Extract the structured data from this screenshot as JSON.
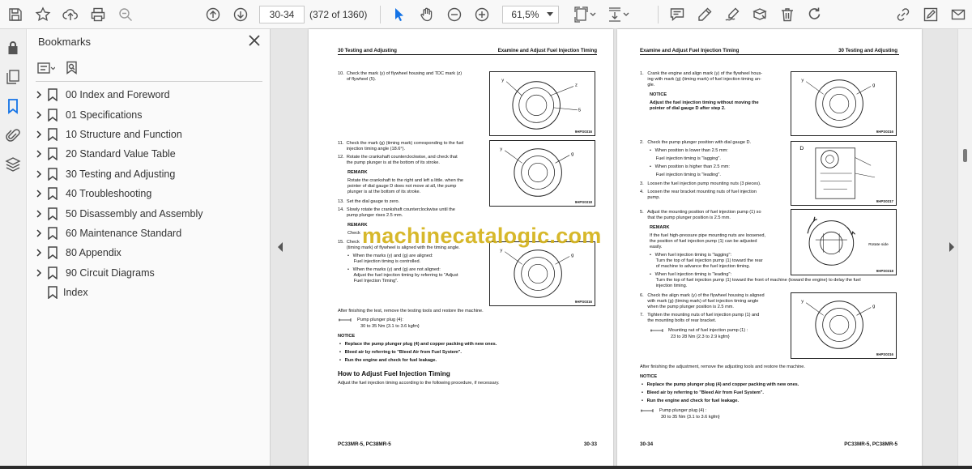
{
  "toolbar": {
    "page_current": "30-34",
    "page_of": "(372 of 1360)",
    "zoom": "61,5%"
  },
  "bookmarks": {
    "title": "Bookmarks",
    "items": [
      {
        "label": "00 Index and Foreword",
        "expandable": true
      },
      {
        "label": "01 Specifications",
        "expandable": true
      },
      {
        "label": "10 Structure and Function",
        "expandable": true
      },
      {
        "label": "20 Standard Value Table",
        "expandable": true
      },
      {
        "label": "30 Testing and Adjusting",
        "expandable": true
      },
      {
        "label": "40 Troubleshooting",
        "expandable": true
      },
      {
        "label": "50 Disassembly and Assembly",
        "expandable": true
      },
      {
        "label": "60 Maintenance Standard",
        "expandable": true
      },
      {
        "label": "80 Appendix",
        "expandable": true
      },
      {
        "label": "90 Circuit Diagrams",
        "expandable": true
      },
      {
        "label": "Index",
        "expandable": false
      }
    ]
  },
  "watermark": "machinecatalogic.com",
  "left_page": {
    "header_left": "30 Testing and Adjusting",
    "header_right": "Examine and Adjust Fuel Injection Timing",
    "footer_left": "PC33MR-5, PC38MR-5",
    "footer_right": "30-33",
    "lines": [
      "10.  Check the mark (y) of flywheel housing and TDC mark (z)",
      "       of flywheel (5).",
      "11.  Check the mark (g) (timing mark) corresponding to the fuel",
      "       injection timing angle (18.6°).",
      "12.  Rotate the crankshaft counterclockwise, and check that",
      "       the pump plunger is at the bottom of its stroke.",
      "REMARK",
      "Rotate the crankshaft to the right and left a little. when the",
      "pointer of dial gauge D does not move at all, the pump",
      "plunger is at the bottom of its stroke.",
      "13.  Set the dial gauge to zero.",
      "14.  Slowly rotate the crankshaft counterclockwise until the",
      "       pump plunger rises 2.5 mm.",
      "REMARK",
      "Check",
      "15.  Check",
      "       (timing mark) of flywheel is aligned with the timing angle.",
      "•   When the marks (y) and (g) are aligned:",
      "     Fuel injection timing is controlled.",
      "•   When the marks (y) and (g) are not aligned:",
      "     Adjust the fuel injection timing by referring to \"Adjust",
      "     Fuel Injection Timing\".",
      "After finishing the test, remove the testing tools and restore the machine.",
      "Pump plunger plug (4):",
      "30 to 35 Nm {3.1 to 3.6 kgfm}",
      "NOTICE",
      "•   Replace the pump plunger plug (4) and copper packing with new ones.",
      "•   Bleed air by referring to \"Bleed Air from Fuel System\".",
      "•   Run the engine and check for fuel leakage.",
      "How to Adjust Fuel Injection Timing",
      "Adjust the fuel injection timing according to the following procedure, if necessary."
    ],
    "fig_codes": [
      "9HPS0316",
      "9HPS0318",
      "9HPS0316"
    ]
  },
  "right_page": {
    "header_left": "Examine and Adjust Fuel Injection Timing",
    "header_right": "30 Testing and Adjusting",
    "footer_left": "30-34",
    "footer_right": "PC33MR-5, PC38MR-5",
    "lines": [
      "1.   Crank the engine and align mark (y) of the flywheel hous-",
      "      ing with mark (g) (timing mark) of fuel injection timing an-",
      "      gle.",
      "NOTICE",
      "Adjust the fuel injection timing without moving the",
      "pointer of dial gauge D after step 2.",
      "2.   Check the pump plunger position with dial gauge D.",
      "•   When position is lower than 2.5 mm:",
      "     Fuel injection timing is \"lagging\".",
      "•   When position is higher than 2.5 mm:",
      "     Fuel injection timing is \"leading\".",
      "3.   Loosen the fuel injection pump mounting nuts (3 pieces).",
      "4.   Loosen the rear bracket mounting nuts of fuel injection",
      "      pump.",
      "5.   Adjust the mounting position of fuel injection pump (1) so",
      "      that the pump plunger position is 2.5 mm.",
      "REMARK",
      "If the fuel high-pressure pipe mounting nuts are loosened,",
      "the position of fuel injection pump (1) can be adjusted",
      "easily.",
      "•   When fuel injection timing is \"lagging\":",
      "     Turn the top of fuel injection pump (1) toward the rear",
      "     of machine to advance the fuel injection timing.",
      "•   When fuel injection timing is \"leading\":",
      "     Turn the top of fuel injection pump (1) toward the front of machine (toward the engine) to delay the fuel",
      "     injection timing.",
      "6.   Check the align mark (y) of the flywheel housing is aligned",
      "      with mark (g) (timing mark) of fuel injection timing angle",
      "      when the pump plunger position is 2.5 mm.",
      "7.   Tighten the mounting nuts of fuel injection pump (1) and",
      "      the mounting bolts of rear bracket.",
      "Mounting nut of fuel injection pump (1) :",
      "23 to 28 Nm {2.3 to 2.9 kgfm}",
      "After finishing the adjustment, remove the adjusting tools and restore the machine.",
      "NOTICE",
      "•   Replace the pump plunger plug (4) and copper packing with new ones.",
      "•   Bleed air by referring to \"Bleed Air from Fuel System\".",
      "•   Run the engine and check for fuel leakage.",
      "Pump plunger plug (4) :",
      "30 to 35 Nm {3.1 to 3.6 kgfm}"
    ],
    "fig_codes": [
      "9HPS0316",
      "9HPS0317",
      "9HPS0318",
      "9HPS0316"
    ],
    "fig_labels": [
      "D",
      "Rotate side"
    ]
  }
}
